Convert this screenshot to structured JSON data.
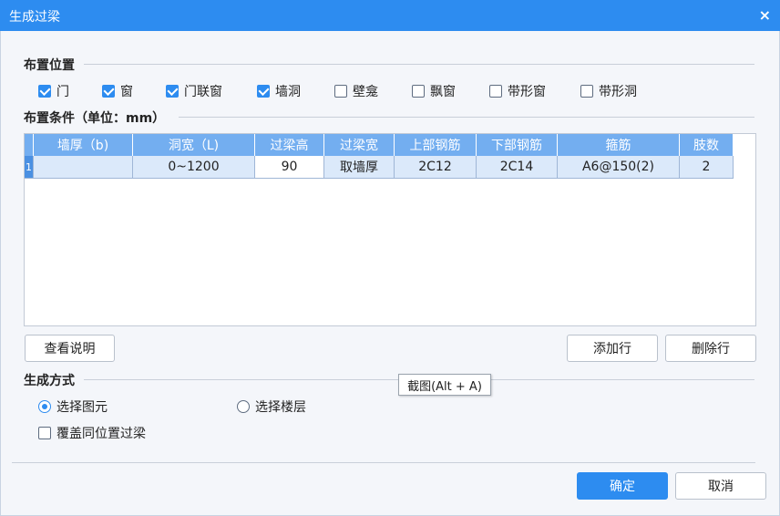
{
  "window": {
    "title": "生成过梁",
    "close_icon": "×"
  },
  "placement": {
    "title": "布置位置",
    "items": [
      {
        "label": "门",
        "checked": true
      },
      {
        "label": "窗",
        "checked": true
      },
      {
        "label": "门联窗",
        "checked": true
      },
      {
        "label": "墙洞",
        "checked": true
      },
      {
        "label": "壁龛",
        "checked": false
      },
      {
        "label": "飘窗",
        "checked": false
      },
      {
        "label": "带形窗",
        "checked": false
      },
      {
        "label": "带形洞",
        "checked": false
      }
    ]
  },
  "conditions": {
    "title": "布置条件（单位：mm）",
    "columns": [
      "墙厚（b)",
      "洞宽（L)",
      "过梁高",
      "过梁宽",
      "上部钢筋",
      "下部钢筋",
      "箍筋",
      "肢数"
    ],
    "rows": [
      {
        "index": "1",
        "cells": [
          "",
          "0~1200",
          "90",
          "取墙厚",
          "2C12",
          "2C14",
          "A6@150(2)",
          "2"
        ]
      }
    ]
  },
  "buttons": {
    "view_help": "查看说明",
    "add_row": "添加行",
    "delete_row": "删除行",
    "ok": "确定",
    "cancel": "取消"
  },
  "generate": {
    "title": "生成方式",
    "options": [
      {
        "label": "选择图元",
        "selected": true
      },
      {
        "label": "选择楼层",
        "selected": false
      }
    ],
    "overwrite_label": "覆盖同位置过梁",
    "overwrite_checked": false
  },
  "tooltip": "截图(Alt + A)",
  "colors": {
    "accent": "#2d8cf0",
    "header": "#73aef0",
    "selected_row": "#dbe9fa"
  }
}
